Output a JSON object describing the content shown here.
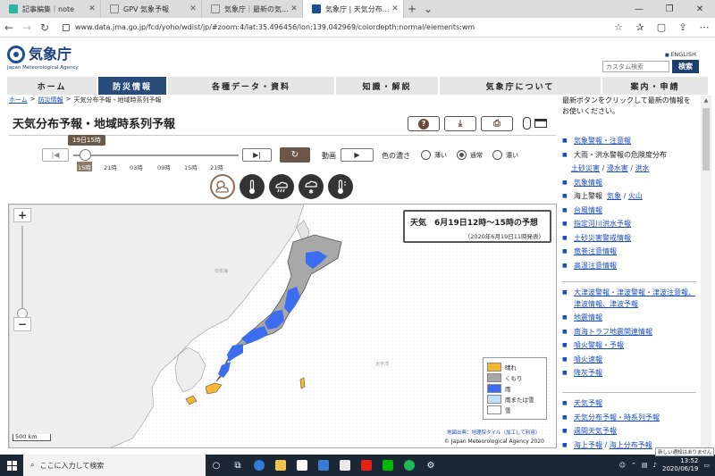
{
  "browser": {
    "tabs": [
      {
        "title": "記事編集｜note",
        "color": "#2ab6a1"
      },
      {
        "title": "GPV 気象予報",
        "color": "#777777"
      },
      {
        "title": "気象庁｜最新の気象データ",
        "color": "#777777"
      },
      {
        "title": "気象庁 | 天気分布予報・地",
        "color": "#1d4f96"
      }
    ],
    "new_tab": "+",
    "url": "www.data.jma.go.jp/fcd/yoho/wdist/jp/#zoom:4/lat:35.496456/lon:139.042969/colordepth:normal/elements:wm"
  },
  "site": {
    "logo_text": "気象庁",
    "logo_sub": "Japan Meteorological Agency",
    "english_link": "ENGLISH",
    "search_placeholder": "カスタム検索",
    "search_button": "検索",
    "nav": [
      "ホーム",
      "防災情報",
      "各種データ・資料",
      "知識・解説",
      "気象庁について",
      "案内・申請"
    ],
    "breadcrumb": [
      "ホーム",
      "防災情報",
      "天気分布予報・地域時系列予報"
    ]
  },
  "page": {
    "title": "天気分布予報・地域時系列予報",
    "buttons": {
      "help": "?",
      "download": "⤓",
      "print": "⎙"
    }
  },
  "timeline": {
    "current_label": "19日15時",
    "ticks": [
      "15時",
      "21時",
      "03時",
      "09時",
      "15時",
      "21時"
    ],
    "animation_label": "動画",
    "density_label": "色の濃さ",
    "density_options": [
      "薄い",
      "通常",
      "濃い"
    ],
    "density_selected": "通常"
  },
  "elements": [
    "weather-icon",
    "temperature-icon",
    "precipitation-icon",
    "snow-icon",
    "max-min-temperature-icon"
  ],
  "map": {
    "zoom_in": "+",
    "zoom_out": "−",
    "info_title": "天気　6月19日12時～15時の予想",
    "info_sub": "（2020年6月19日11時発表）",
    "legend": [
      {
        "label": "晴れ",
        "color": "#f5b731"
      },
      {
        "label": "くもり",
        "color": "#a8a8a8"
      },
      {
        "label": "雨",
        "color": "#3c6df0"
      },
      {
        "label": "雨または雪",
        "color": "#bfe0f5"
      },
      {
        "label": "雪",
        "color": "#ffffff"
      }
    ],
    "scale": "500 km",
    "credit_tile": "地図出典：地理院タイル（加工して利用）",
    "credit_copy": "© Japan Meteorological Agency 2020"
  },
  "sidebar": {
    "intro": "最新ボタンをクリックして最新の情報をお使いください。",
    "group1": [
      {
        "text": "気象警報・注意報",
        "link": true
      },
      {
        "text": "大雨・洪水警報の危険度分布",
        "link": false,
        "sub": [
          "土砂災害",
          "浸水害",
          "洪水"
        ]
      },
      {
        "text": "気象情報",
        "link": true
      },
      {
        "text": "海上警報",
        "link": false,
        "sub_inline": [
          "気象",
          "火山"
        ]
      },
      {
        "text": "台風情報",
        "link": true
      },
      {
        "text": "指定河川洪水予報",
        "link": true
      },
      {
        "text": "土砂災害警戒情報",
        "link": true
      },
      {
        "text": "竜巻注意情報",
        "link": true
      },
      {
        "text": "高温注意情報",
        "link": true
      }
    ],
    "group2": [
      {
        "text": "大津波警報・津波警報・津波注意報、津波情報、津波予報",
        "link": true
      },
      {
        "text": "地震情報",
        "link": true
      },
      {
        "text": "南海トラフ地震関連情報",
        "link": true
      },
      {
        "text": "噴火警報・予報",
        "link": true
      },
      {
        "text": "噴火速報",
        "link": true
      },
      {
        "text": "降灰予報",
        "link": true
      }
    ],
    "group3": [
      {
        "text": "天気予報",
        "link": true
      },
      {
        "text": "天気分布予報・時系列予報",
        "link": true
      },
      {
        "text": "週間天気予報",
        "link": true
      },
      {
        "text": "海上予報",
        "link": true,
        "sub_inline": [
          "海上分布予報"
        ]
      }
    ]
  },
  "taskbar": {
    "search_placeholder": "ここに入力して検索",
    "time": "13:52",
    "date": "2020/06/19",
    "toast": "新しい通知はありません"
  }
}
